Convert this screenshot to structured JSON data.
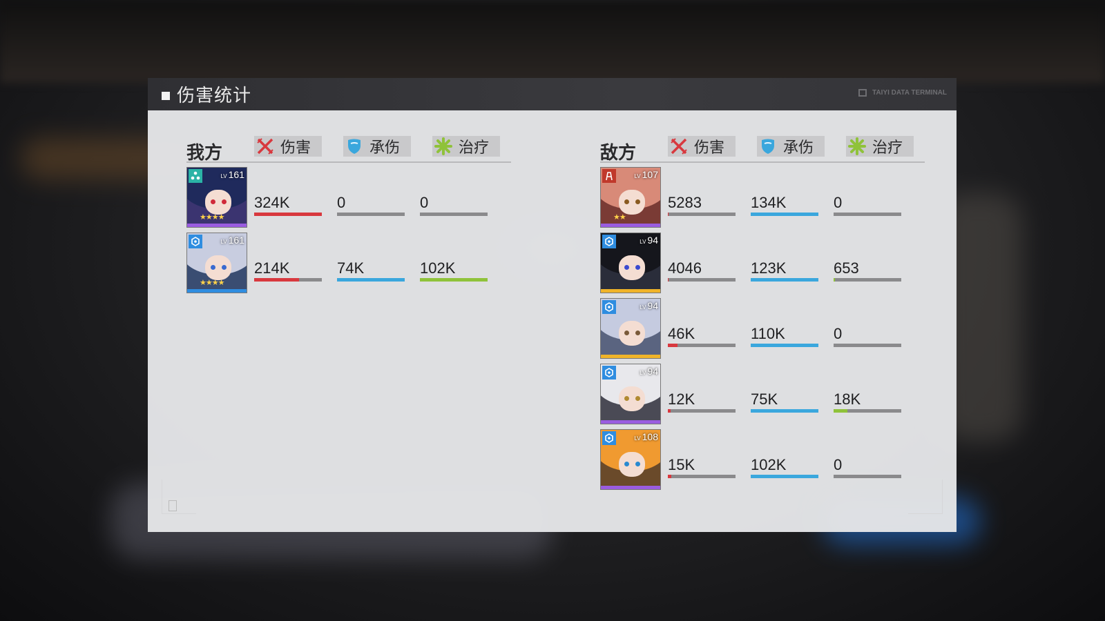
{
  "header": {
    "title": "伤害统计",
    "terminal_label": "TAIYI DATA TERMINAL"
  },
  "columns": {
    "damage": "伤害",
    "taken": "承伤",
    "heal": "治疗"
  },
  "colors": {
    "damage": "#d8383e",
    "taken": "#3aa7dd",
    "heal": "#8fc23a",
    "purple": "#9a5ce0",
    "gold": "#f0b429",
    "blue": "#2f8de0"
  },
  "allies": {
    "label": "我方",
    "members": [
      {
        "level": "161",
        "class_icon": "support-class-icon",
        "rarity": "purple",
        "damage": "324K",
        "damage_pct": 1.0,
        "taken": "0",
        "taken_pct": 0,
        "heal": "0",
        "heal_pct": 0
      },
      {
        "level": "161",
        "class_icon": "shield-class-icon",
        "rarity": "blue",
        "damage": "214K",
        "damage_pct": 0.66,
        "taken": "74K",
        "taken_pct": 1.0,
        "heal": "102K",
        "heal_pct": 1.0
      }
    ]
  },
  "enemies": {
    "label": "敌方",
    "members": [
      {
        "level": "107",
        "class_icon": "tower-class-icon",
        "rarity": "purple",
        "damage": "5283",
        "damage_pct": 0.01,
        "taken": "134K",
        "taken_pct": 1.0,
        "heal": "0",
        "heal_pct": 0
      },
      {
        "level": "94",
        "class_icon": "shield-class-icon",
        "rarity": "gold",
        "damage": "4046",
        "damage_pct": 0.01,
        "taken": "123K",
        "taken_pct": 1.0,
        "heal": "653",
        "heal_pct": 0.02
      },
      {
        "level": "94",
        "class_icon": "shield-class-icon",
        "rarity": "gold",
        "damage": "46K",
        "damage_pct": 0.14,
        "taken": "110K",
        "taken_pct": 1.0,
        "heal": "0",
        "heal_pct": 0
      },
      {
        "level": "94",
        "class_icon": "shield-class-icon",
        "rarity": "purple",
        "damage": "12K",
        "damage_pct": 0.04,
        "taken": "75K",
        "taken_pct": 1.0,
        "heal": "18K",
        "heal_pct": 0.2
      },
      {
        "level": "108",
        "class_icon": "shield-class-icon",
        "rarity": "purple",
        "damage": "15K",
        "damage_pct": 0.05,
        "taken": "102K",
        "taken_pct": 1.0,
        "heal": "0",
        "heal_pct": 0
      }
    ]
  }
}
